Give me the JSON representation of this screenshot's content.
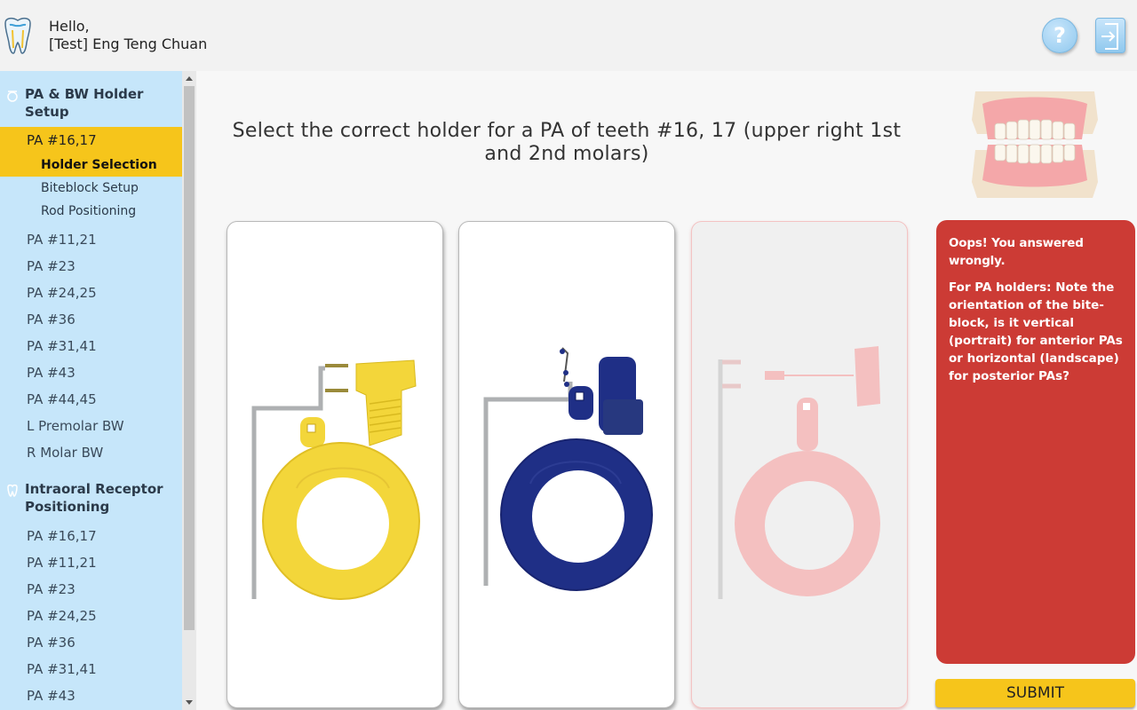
{
  "header": {
    "greeting_line1": "Hello,",
    "greeting_line2": "[Test] Eng Teng Chuan",
    "help_label": "?"
  },
  "sidebar": {
    "section1": {
      "title": "PA & BW Holder Setup",
      "items": [
        {
          "label": "PA #16,17",
          "active": true
        },
        {
          "label": "PA #11,21"
        },
        {
          "label": "PA #23"
        },
        {
          "label": "PA #24,25"
        },
        {
          "label": "PA #36"
        },
        {
          "label": "PA #31,41"
        },
        {
          "label": "PA #43"
        },
        {
          "label": "PA #44,45"
        },
        {
          "label": "L Premolar BW"
        },
        {
          "label": "R Molar BW"
        }
      ],
      "subitems": [
        {
          "label": "Holder Selection",
          "active": true
        },
        {
          "label": "Biteblock Setup"
        },
        {
          "label": "Rod Positioning"
        }
      ]
    },
    "section2": {
      "title": "Intraoral Receptor Positioning",
      "items": [
        {
          "label": "PA #16,17"
        },
        {
          "label": "PA #11,21"
        },
        {
          "label": "PA #23"
        },
        {
          "label": "PA #24,25"
        },
        {
          "label": "PA #36"
        },
        {
          "label": "PA #31,41"
        },
        {
          "label": "PA #43"
        }
      ]
    }
  },
  "main": {
    "question": "Select the correct holder for a PA of teeth #16, 17 (upper right 1st and 2nd molars)",
    "options": [
      {
        "holder": "yellow",
        "color": "#f3d63a",
        "state": "default"
      },
      {
        "holder": "blue",
        "color": "#1f2f86",
        "state": "default"
      },
      {
        "holder": "red",
        "color": "#f2b8b8",
        "state": "wrong"
      }
    ],
    "feedback": {
      "title": "Oops! You answered wrongly.",
      "body": "For PA holders: Note the orientation of the bite-block, is it vertical (portrait) for anterior PAs or horizontal (landscape) for posterior PAs?"
    },
    "submit_label": "SUBMIT"
  },
  "colors": {
    "sidebar_bg": "#c6e6fa",
    "active_item": "#f6c51b",
    "feedback_bg": "#cc3b35",
    "submit_bg": "#f6c51b"
  }
}
